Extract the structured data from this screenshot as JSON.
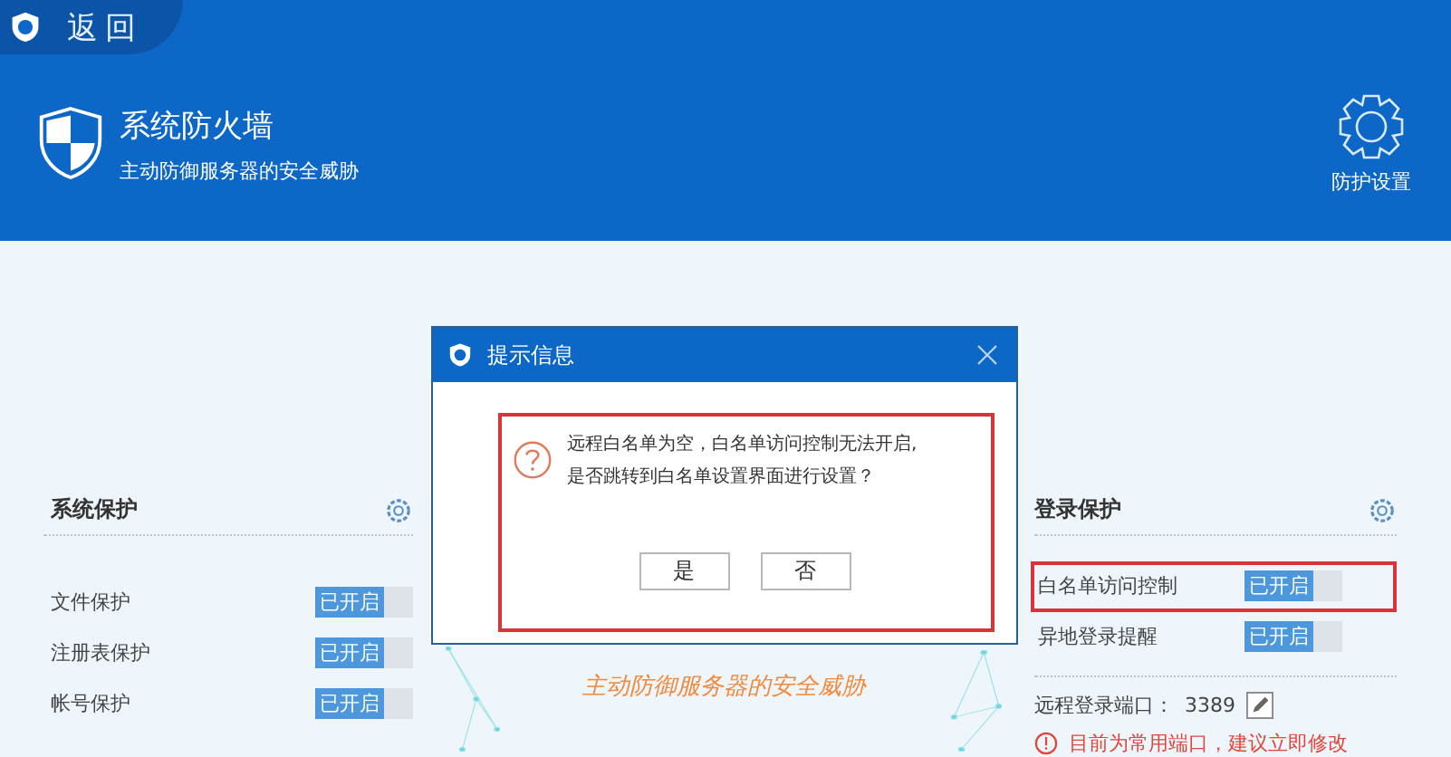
{
  "titlebar": {
    "back_label": "返回"
  },
  "header": {
    "title": "系统防火墙",
    "subtitle": "主动防御服务器的安全威胁",
    "settings_label": "防护设置"
  },
  "system_protection": {
    "title": "系统保护",
    "items": [
      {
        "label": "文件保护",
        "toggle": "已开启",
        "on": true
      },
      {
        "label": "注册表保护",
        "toggle": "已开启",
        "on": true
      },
      {
        "label": "帐号保护",
        "toggle": "已开启",
        "on": true
      }
    ]
  },
  "center": {
    "subtitle": "主动防御服务器的安全威胁"
  },
  "login_protection": {
    "title": "登录保护",
    "items": [
      {
        "label": "白名单访问控制",
        "toggle": "已开启",
        "on": true,
        "highlighted": true
      },
      {
        "label": "异地登录提醒",
        "toggle": "已开启",
        "on": true,
        "highlighted": false
      }
    ],
    "port_label": "远程登录端口：",
    "port_value": "3389",
    "warning": "目前为常用端口，建议立即修改"
  },
  "dialog": {
    "title": "提示信息",
    "message": [
      "远程白名单为空，白名单访问控制无法开启,",
      "是否跳转到白名单设置界面进行设置？"
    ],
    "highlighted": true,
    "buttons": [
      "是",
      "否"
    ]
  }
}
